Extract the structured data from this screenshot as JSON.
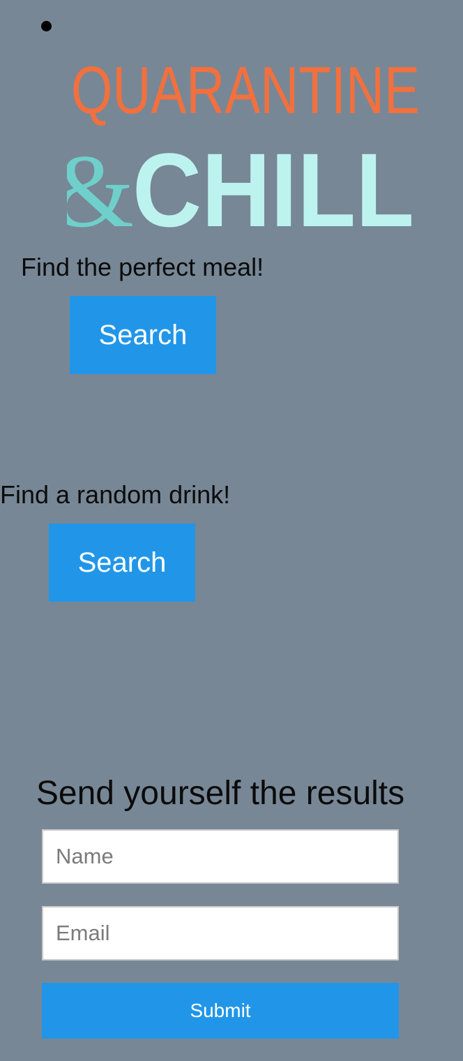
{
  "nav": {
    "bullet_icon": "bullet-icon"
  },
  "logo": {
    "line1": "QUARANTINE",
    "ampersand": "&",
    "line2": "CHILL",
    "colors": {
      "line1": "#f2703e",
      "ampersand": "#6fcfcb",
      "line2": "#bdf3ef"
    }
  },
  "meal": {
    "label": "Find the perfect meal!",
    "button_label": "Search"
  },
  "drink": {
    "label": "Find a random drink!",
    "button_label": "Search"
  },
  "form": {
    "title": "Send yourself the results",
    "name_placeholder": "Name",
    "email_placeholder": "Email",
    "submit_label": "Submit"
  },
  "colors": {
    "background": "#778796",
    "button": "#2196e8",
    "button_text": "#ffffff"
  }
}
